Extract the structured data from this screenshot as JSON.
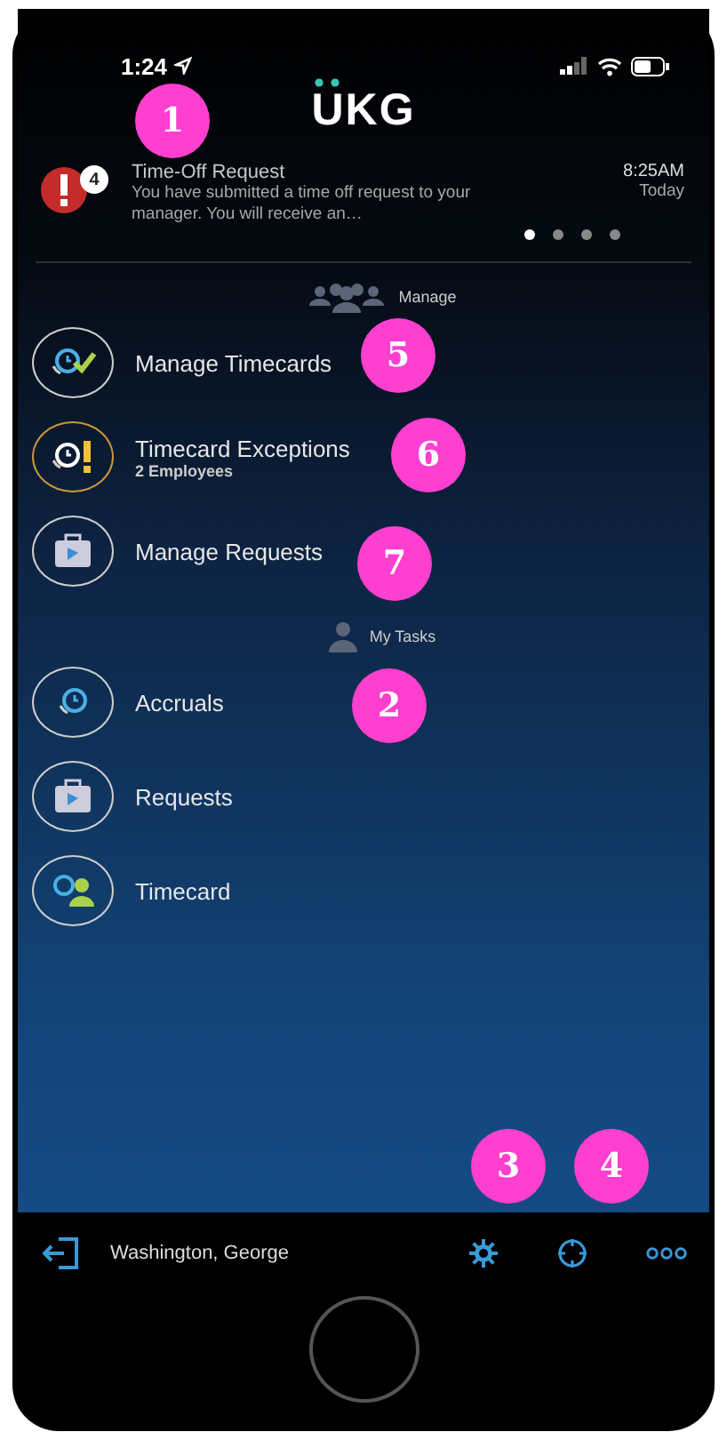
{
  "status_bar": {
    "time": "1:24"
  },
  "logo": {
    "text": "UKG"
  },
  "notification": {
    "count": "4",
    "title": "Time-Off Request",
    "message": "You have submitted a time off request to your manager.  You will receive an…",
    "time": "8:25AM",
    "day": "Today"
  },
  "pager": [
    {
      "selected": true
    },
    {
      "selected": false
    },
    {
      "selected": false
    },
    {
      "selected": false
    }
  ],
  "sections": [
    {
      "title": "Manage",
      "kind": "group",
      "items": [
        {
          "label": "Manage Timecards",
          "kind": "approve"
        },
        {
          "label": "Timecard Exceptions",
          "subtitle": "2 Employees",
          "kind": "exception"
        },
        {
          "label": "Manage Requests",
          "kind": "suitcase"
        }
      ]
    },
    {
      "title": "My Tasks",
      "kind": "person",
      "items": [
        {
          "label": "Accruals",
          "kind": "clock"
        },
        {
          "label": "Requests",
          "kind": "suitcase"
        },
        {
          "label": "Timecard",
          "kind": "employee"
        }
      ]
    }
  ],
  "footer": {
    "user": "Washington, George"
  },
  "callouts": [
    "1",
    "5",
    "6",
    "7",
    "2",
    "3",
    "4"
  ]
}
